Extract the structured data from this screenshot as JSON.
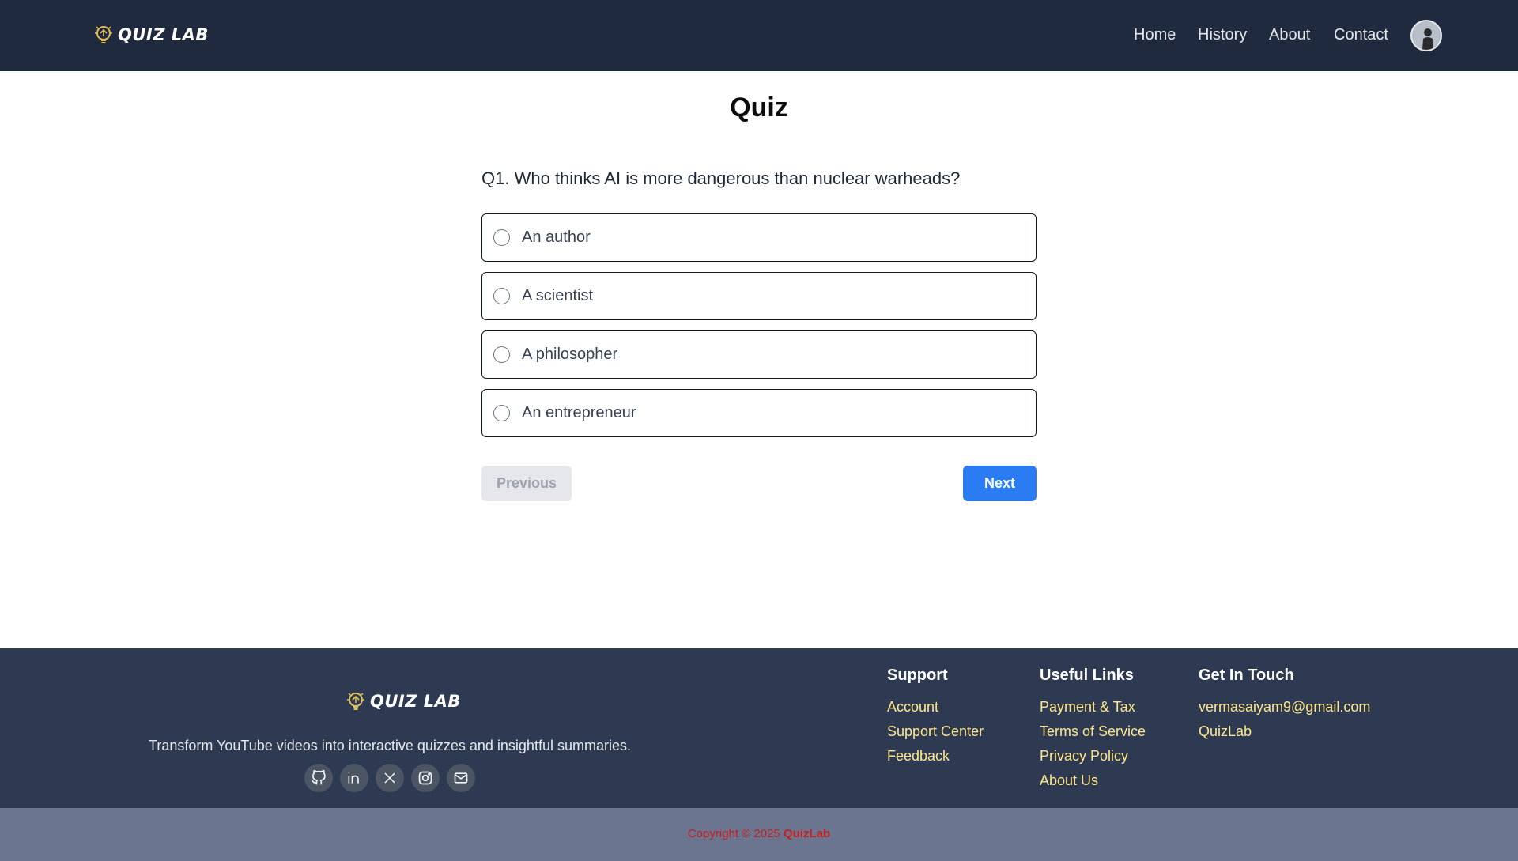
{
  "header": {
    "brand": "QUIZ LAB",
    "nav": [
      "Home",
      "History",
      "About",
      "Contact"
    ]
  },
  "main": {
    "title": "Quiz",
    "question_number": "Q1.",
    "question_text": "Who thinks AI is more dangerous than nuclear warheads?",
    "options": [
      "An author",
      "A scientist",
      "A philosopher",
      "An entrepreneur"
    ],
    "previous_label": "Previous",
    "next_label": "Next"
  },
  "footer": {
    "brand": "QUIZ LAB",
    "tagline": "Transform YouTube videos into interactive quizzes and insightful summaries.",
    "socials": [
      "github-icon",
      "linkedin-icon",
      "x-icon",
      "instagram-icon",
      "mail-icon"
    ],
    "support": {
      "heading": "Support",
      "links": [
        "Account",
        "Support Center",
        "Feedback"
      ]
    },
    "useful_links": {
      "heading": "Useful Links",
      "links": [
        "Payment & Tax",
        "Terms of Service",
        "Privacy Policy",
        "About Us"
      ]
    },
    "get_in_touch": {
      "heading": "Get In Touch",
      "links": [
        "vermasaiyam9@gmail.com",
        "QuizLab"
      ]
    },
    "copyright_prefix": "Copyright © 2025",
    "copyright_brand": "QuizLab"
  },
  "colors": {
    "header_bg": "#1f2a3e",
    "footer_bg": "#2e3a52",
    "copyright_bg": "#6b7590",
    "accent": "#2b7cf2",
    "footer_link": "#fde68a",
    "copyright_text": "#c81e1e"
  }
}
